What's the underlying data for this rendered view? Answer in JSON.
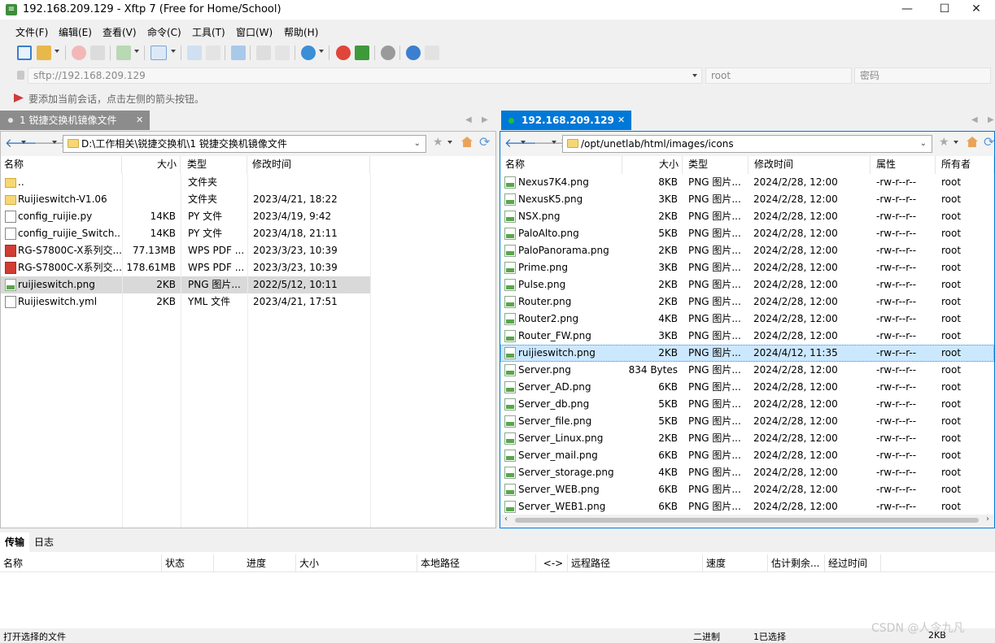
{
  "window": {
    "title": "192.168.209.129 - Xftp 7 (Free for Home/School)",
    "minimize": "—",
    "maximize": "☐",
    "close": "✕"
  },
  "menu": [
    "文件(F)",
    "编辑(E)",
    "查看(V)",
    "命令(C)",
    "工具(T)",
    "窗口(W)",
    "帮助(H)"
  ],
  "address": {
    "url_placeholder": "sftp://192.168.209.129",
    "user_placeholder": "root",
    "password_placeholder": "密码"
  },
  "hint": "要添加当前会话，点击左侧的箭头按钮。",
  "left": {
    "tab_label": "1 锐捷交换机镜像文件",
    "path": "D:\\工作相关\\锐捷交换机\\1 锐捷交换机镜像文件",
    "columns": [
      "名称",
      "大小",
      "类型",
      "修改时间"
    ],
    "rows": [
      {
        "icon": "folder",
        "name": "..",
        "size": "",
        "type": "文件夹",
        "modified": ""
      },
      {
        "icon": "folder",
        "name": "Ruijieswitch-V1.06",
        "size": "",
        "type": "文件夹",
        "modified": "2023/4/21, 18:22"
      },
      {
        "icon": "doc",
        "name": "config_ruijie.py",
        "size": "14KB",
        "type": "PY 文件",
        "modified": "2023/4/19, 9:42"
      },
      {
        "icon": "doc",
        "name": "config_ruijie_Switch....",
        "size": "14KB",
        "type": "PY 文件",
        "modified": "2023/4/18, 21:11"
      },
      {
        "icon": "pdf",
        "name": "RG-S7800C-X系列交...",
        "size": "77.13MB",
        "type": "WPS PDF ...",
        "modified": "2023/3/23, 10:39"
      },
      {
        "icon": "pdf",
        "name": "RG-S7800C-X系列交...",
        "size": "178.61MB",
        "type": "WPS PDF ...",
        "modified": "2023/3/23, 10:39"
      },
      {
        "icon": "png",
        "name": "ruijieswitch.png",
        "size": "2KB",
        "type": "PNG 图片...",
        "modified": "2022/5/12, 10:11",
        "selected": true
      },
      {
        "icon": "doc",
        "name": "Ruijieswitch.yml",
        "size": "2KB",
        "type": "YML 文件",
        "modified": "2023/4/21, 17:51"
      }
    ]
  },
  "right": {
    "tab_label": "192.168.209.129",
    "path": "/opt/unetlab/html/images/icons",
    "columns": [
      "名称",
      "大小",
      "类型",
      "修改时间",
      "属性",
      "所有者"
    ],
    "rows": [
      {
        "name": "Nexus7K4.png",
        "size": "8KB",
        "type": "PNG 图片...",
        "modified": "2024/2/28, 12:00",
        "attr": "-rw-r--r--",
        "owner": "root"
      },
      {
        "name": "NexusK5.png",
        "size": "3KB",
        "type": "PNG 图片...",
        "modified": "2024/2/28, 12:00",
        "attr": "-rw-r--r--",
        "owner": "root"
      },
      {
        "name": "NSX.png",
        "size": "2KB",
        "type": "PNG 图片...",
        "modified": "2024/2/28, 12:00",
        "attr": "-rw-r--r--",
        "owner": "root"
      },
      {
        "name": "PaloAlto.png",
        "size": "5KB",
        "type": "PNG 图片...",
        "modified": "2024/2/28, 12:00",
        "attr": "-rw-r--r--",
        "owner": "root"
      },
      {
        "name": "PaloPanorama.png",
        "size": "2KB",
        "type": "PNG 图片...",
        "modified": "2024/2/28, 12:00",
        "attr": "-rw-r--r--",
        "owner": "root"
      },
      {
        "name": "Prime.png",
        "size": "3KB",
        "type": "PNG 图片...",
        "modified": "2024/2/28, 12:00",
        "attr": "-rw-r--r--",
        "owner": "root"
      },
      {
        "name": "Pulse.png",
        "size": "2KB",
        "type": "PNG 图片...",
        "modified": "2024/2/28, 12:00",
        "attr": "-rw-r--r--",
        "owner": "root"
      },
      {
        "name": "Router.png",
        "size": "2KB",
        "type": "PNG 图片...",
        "modified": "2024/2/28, 12:00",
        "attr": "-rw-r--r--",
        "owner": "root"
      },
      {
        "name": "Router2.png",
        "size": "4KB",
        "type": "PNG 图片...",
        "modified": "2024/2/28, 12:00",
        "attr": "-rw-r--r--",
        "owner": "root"
      },
      {
        "name": "Router_FW.png",
        "size": "3KB",
        "type": "PNG 图片...",
        "modified": "2024/2/28, 12:00",
        "attr": "-rw-r--r--",
        "owner": "root"
      },
      {
        "name": "ruijieswitch.png",
        "size": "2KB",
        "type": "PNG 图片...",
        "modified": "2024/4/12, 11:35",
        "attr": "-rw-r--r--",
        "owner": "root",
        "selected": true
      },
      {
        "name": "Server.png",
        "size": "834 Bytes",
        "type": "PNG 图片...",
        "modified": "2024/2/28, 12:00",
        "attr": "-rw-r--r--",
        "owner": "root"
      },
      {
        "name": "Server_AD.png",
        "size": "6KB",
        "type": "PNG 图片...",
        "modified": "2024/2/28, 12:00",
        "attr": "-rw-r--r--",
        "owner": "root"
      },
      {
        "name": "Server_db.png",
        "size": "5KB",
        "type": "PNG 图片...",
        "modified": "2024/2/28, 12:00",
        "attr": "-rw-r--r--",
        "owner": "root"
      },
      {
        "name": "Server_file.png",
        "size": "5KB",
        "type": "PNG 图片...",
        "modified": "2024/2/28, 12:00",
        "attr": "-rw-r--r--",
        "owner": "root"
      },
      {
        "name": "Server_Linux.png",
        "size": "2KB",
        "type": "PNG 图片...",
        "modified": "2024/2/28, 12:00",
        "attr": "-rw-r--r--",
        "owner": "root"
      },
      {
        "name": "Server_mail.png",
        "size": "6KB",
        "type": "PNG 图片...",
        "modified": "2024/2/28, 12:00",
        "attr": "-rw-r--r--",
        "owner": "root"
      },
      {
        "name": "Server_storage.png",
        "size": "4KB",
        "type": "PNG 图片...",
        "modified": "2024/2/28, 12:00",
        "attr": "-rw-r--r--",
        "owner": "root"
      },
      {
        "name": "Server_WEB.png",
        "size": "6KB",
        "type": "PNG 图片...",
        "modified": "2024/2/28, 12:00",
        "attr": "-rw-r--r--",
        "owner": "root"
      },
      {
        "name": "Server_WEB1.png",
        "size": "6KB",
        "type": "PNG 图片...",
        "modified": "2024/2/28, 12:00",
        "attr": "-rw-r--r--",
        "owner": "root"
      }
    ]
  },
  "bottom": {
    "tabs": [
      "传输",
      "日志"
    ],
    "columns": [
      "名称",
      "状态",
      "进度",
      "大小",
      "本地路径",
      "<->",
      "远程路径",
      "速度",
      "估计剩余...",
      "经过时间"
    ]
  },
  "status": {
    "left": "打开选择的文件",
    "mode": "二进制",
    "selection": "1已选择",
    "size": "2KB"
  },
  "watermark": "CSDN @人令九凡",
  "colors": {
    "selected_row": "#cce8ff",
    "selected_row_left": "#d9d9d9",
    "active_tab": "#0078d7",
    "session_dot": "#1fbf3a"
  }
}
